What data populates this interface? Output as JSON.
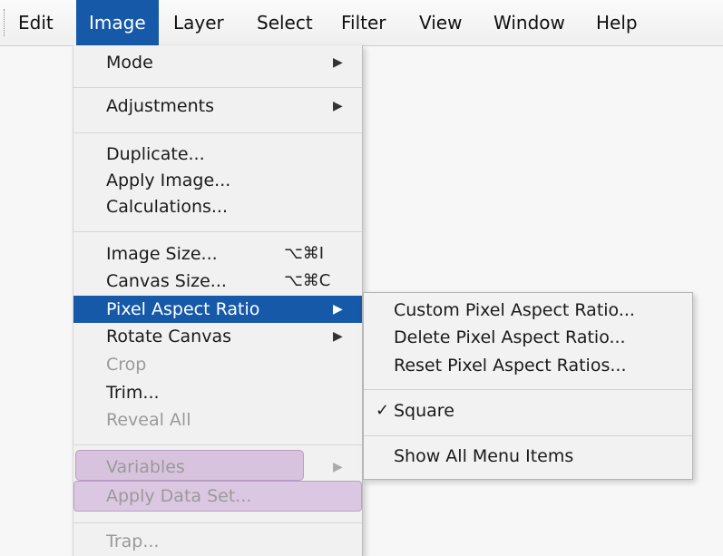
{
  "menubar": {
    "items": [
      "Edit",
      "Image",
      "Layer",
      "Select",
      "Filter",
      "View",
      "Window",
      "Help"
    ],
    "active": "Image"
  },
  "image_menu": {
    "mode": "Mode",
    "adjustments": "Adjustments",
    "duplicate": "Duplicate...",
    "apply_image": "Apply Image...",
    "calculations": "Calculations...",
    "image_size": "Image Size...",
    "image_size_shortcut": "⌥⌘I",
    "canvas_size": "Canvas Size...",
    "canvas_size_shortcut": "⌥⌘C",
    "pixel_aspect_ratio": "Pixel Aspect Ratio",
    "rotate_canvas": "Rotate Canvas",
    "crop": "Crop",
    "trim": "Trim...",
    "reveal_all": "Reveal All",
    "variables": "Variables",
    "apply_data_set": "Apply Data Set...",
    "trap": "Trap..."
  },
  "submenu": {
    "custom": "Custom Pixel Aspect Ratio...",
    "delete": "Delete Pixel Aspect Ratio...",
    "reset": "Reset Pixel Aspect Ratios...",
    "square": "Square",
    "square_checked": true,
    "show_all": "Show All Menu Items"
  },
  "glyphs": {
    "arrow": "▶",
    "check": "✓"
  },
  "colors": {
    "highlight": "#1559a8",
    "purple_highlight": "#d8c3df"
  }
}
